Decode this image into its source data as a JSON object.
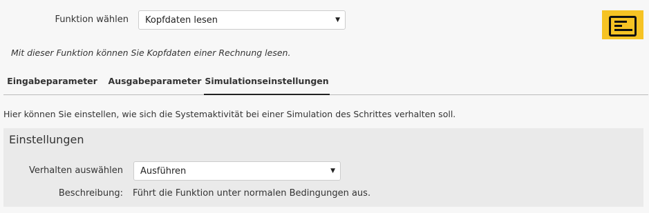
{
  "function": {
    "label": "Funktion wählen",
    "selected": "Kopfdaten lesen",
    "description": "Mit dieser Funktion können Sie Kopfdaten einer Rechnung lesen."
  },
  "icon": {
    "name": "document-icon",
    "background": "#f6c324"
  },
  "tabs": [
    {
      "label": "Eingabeparameter",
      "active": false
    },
    {
      "label": "Ausgabeparameter",
      "active": false
    },
    {
      "label": "Simulationseinstellungen",
      "active": true
    }
  ],
  "info_text": "Hier können Sie einstellen, wie sich die Systemaktivität bei einer Simulation des Schrittes verhalten soll.",
  "settings": {
    "title": "Einstellungen",
    "behavior_label": "Verhalten auswählen",
    "behavior_selected": "Ausführen",
    "description_label": "Beschreibung:",
    "description_value": "Führt die Funktion unter normalen Bedingungen aus."
  }
}
